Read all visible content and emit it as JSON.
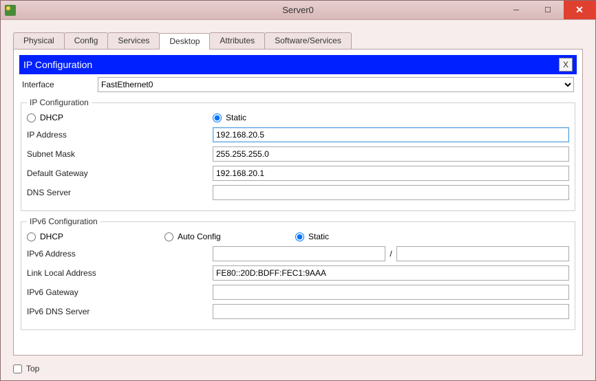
{
  "window": {
    "title": "Server0"
  },
  "tabs": {
    "items": [
      "Physical",
      "Config",
      "Services",
      "Desktop",
      "Attributes",
      "Software/Services"
    ],
    "active_index": 3
  },
  "panel": {
    "title": "IP Configuration",
    "close_symbol": "X"
  },
  "interface": {
    "label": "Interface",
    "selected": "FastEthernet0"
  },
  "ipv4": {
    "legend": "IP Configuration",
    "dhcp_label": "DHCP",
    "static_label": "Static",
    "mode": "static",
    "ip_label": "IP Address",
    "ip_value": "192.168.20.5",
    "mask_label": "Subnet Mask",
    "mask_value": "255.255.255.0",
    "gw_label": "Default Gateway",
    "gw_value": "192.168.20.1",
    "dns_label": "DNS Server",
    "dns_value": ""
  },
  "ipv6": {
    "legend": "IPv6 Configuration",
    "dhcp_label": "DHCP",
    "auto_label": "Auto Config",
    "static_label": "Static",
    "mode": "static",
    "addr_label": "IPv6 Address",
    "addr_value": "",
    "prefix_sep": "/",
    "prefix_value": "",
    "ll_label": "Link Local Address",
    "ll_value": "FE80::20D:BDFF:FEC1:9AAA",
    "gw_label": "IPv6 Gateway",
    "gw_value": "",
    "dns_label": "IPv6 DNS Server",
    "dns_value": ""
  },
  "footer": {
    "top_label": "Top",
    "top_checked": false
  }
}
